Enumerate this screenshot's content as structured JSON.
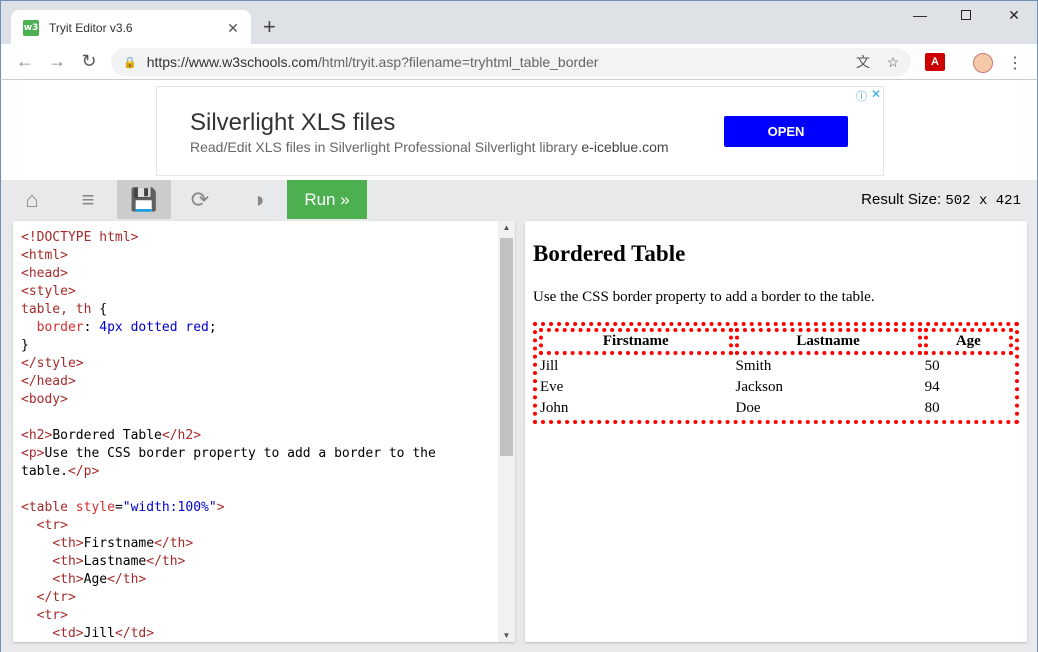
{
  "browser": {
    "tab_title": "Tryit Editor v3.6",
    "favicon_text": "w3",
    "url_host": "https://www.w3schools.com",
    "url_path": "/html/tryit.asp?filename=tryhtml_table_border"
  },
  "ad": {
    "title": "Silverlight XLS files",
    "subtitle": "Read/Edit XLS files in Silverlight Professional Silverlight library",
    "subtitle_brand": "e-iceblue.com",
    "button": "OPEN"
  },
  "toolbar": {
    "run_label": "Run »",
    "result_size_label": "Result Size:",
    "result_size_value": "502 x 421"
  },
  "result": {
    "heading": "Bordered Table",
    "paragraph": "Use the CSS border property to add a border to the table.",
    "headers": [
      "Firstname",
      "Lastname",
      "Age"
    ],
    "rows": [
      [
        "Jill",
        "Smith",
        "50"
      ],
      [
        "Eve",
        "Jackson",
        "94"
      ],
      [
        "John",
        "Doe",
        "80"
      ]
    ]
  },
  "colors": {
    "run_button": "#4caf50",
    "ad_button": "#0000ff",
    "table_border": "red"
  }
}
